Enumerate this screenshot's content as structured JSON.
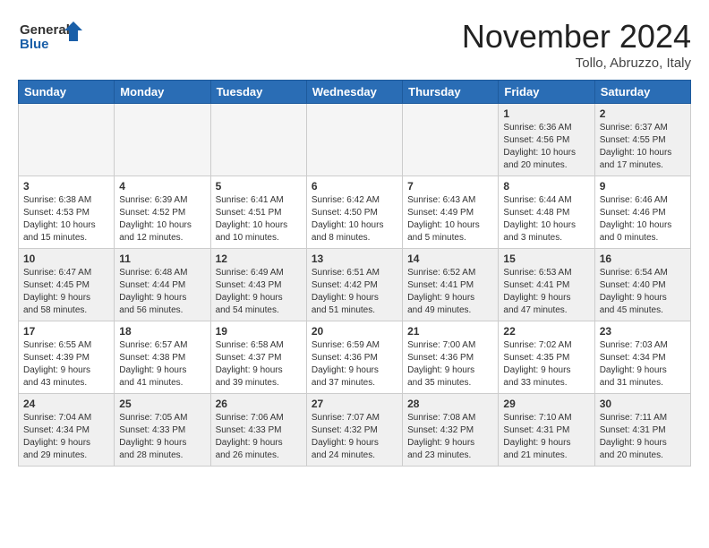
{
  "logo": {
    "line1": "General",
    "line2": "Blue"
  },
  "header": {
    "month": "November 2024",
    "location": "Tollo, Abruzzo, Italy"
  },
  "weekdays": [
    "Sunday",
    "Monday",
    "Tuesday",
    "Wednesday",
    "Thursday",
    "Friday",
    "Saturday"
  ],
  "weeks": [
    [
      {
        "day": "",
        "info": ""
      },
      {
        "day": "",
        "info": ""
      },
      {
        "day": "",
        "info": ""
      },
      {
        "day": "",
        "info": ""
      },
      {
        "day": "",
        "info": ""
      },
      {
        "day": "1",
        "info": "Sunrise: 6:36 AM\nSunset: 4:56 PM\nDaylight: 10 hours\nand 20 minutes."
      },
      {
        "day": "2",
        "info": "Sunrise: 6:37 AM\nSunset: 4:55 PM\nDaylight: 10 hours\nand 17 minutes."
      }
    ],
    [
      {
        "day": "3",
        "info": "Sunrise: 6:38 AM\nSunset: 4:53 PM\nDaylight: 10 hours\nand 15 minutes."
      },
      {
        "day": "4",
        "info": "Sunrise: 6:39 AM\nSunset: 4:52 PM\nDaylight: 10 hours\nand 12 minutes."
      },
      {
        "day": "5",
        "info": "Sunrise: 6:41 AM\nSunset: 4:51 PM\nDaylight: 10 hours\nand 10 minutes."
      },
      {
        "day": "6",
        "info": "Sunrise: 6:42 AM\nSunset: 4:50 PM\nDaylight: 10 hours\nand 8 minutes."
      },
      {
        "day": "7",
        "info": "Sunrise: 6:43 AM\nSunset: 4:49 PM\nDaylight: 10 hours\nand 5 minutes."
      },
      {
        "day": "8",
        "info": "Sunrise: 6:44 AM\nSunset: 4:48 PM\nDaylight: 10 hours\nand 3 minutes."
      },
      {
        "day": "9",
        "info": "Sunrise: 6:46 AM\nSunset: 4:46 PM\nDaylight: 10 hours\nand 0 minutes."
      }
    ],
    [
      {
        "day": "10",
        "info": "Sunrise: 6:47 AM\nSunset: 4:45 PM\nDaylight: 9 hours\nand 58 minutes."
      },
      {
        "day": "11",
        "info": "Sunrise: 6:48 AM\nSunset: 4:44 PM\nDaylight: 9 hours\nand 56 minutes."
      },
      {
        "day": "12",
        "info": "Sunrise: 6:49 AM\nSunset: 4:43 PM\nDaylight: 9 hours\nand 54 minutes."
      },
      {
        "day": "13",
        "info": "Sunrise: 6:51 AM\nSunset: 4:42 PM\nDaylight: 9 hours\nand 51 minutes."
      },
      {
        "day": "14",
        "info": "Sunrise: 6:52 AM\nSunset: 4:41 PM\nDaylight: 9 hours\nand 49 minutes."
      },
      {
        "day": "15",
        "info": "Sunrise: 6:53 AM\nSunset: 4:41 PM\nDaylight: 9 hours\nand 47 minutes."
      },
      {
        "day": "16",
        "info": "Sunrise: 6:54 AM\nSunset: 4:40 PM\nDaylight: 9 hours\nand 45 minutes."
      }
    ],
    [
      {
        "day": "17",
        "info": "Sunrise: 6:55 AM\nSunset: 4:39 PM\nDaylight: 9 hours\nand 43 minutes."
      },
      {
        "day": "18",
        "info": "Sunrise: 6:57 AM\nSunset: 4:38 PM\nDaylight: 9 hours\nand 41 minutes."
      },
      {
        "day": "19",
        "info": "Sunrise: 6:58 AM\nSunset: 4:37 PM\nDaylight: 9 hours\nand 39 minutes."
      },
      {
        "day": "20",
        "info": "Sunrise: 6:59 AM\nSunset: 4:36 PM\nDaylight: 9 hours\nand 37 minutes."
      },
      {
        "day": "21",
        "info": "Sunrise: 7:00 AM\nSunset: 4:36 PM\nDaylight: 9 hours\nand 35 minutes."
      },
      {
        "day": "22",
        "info": "Sunrise: 7:02 AM\nSunset: 4:35 PM\nDaylight: 9 hours\nand 33 minutes."
      },
      {
        "day": "23",
        "info": "Sunrise: 7:03 AM\nSunset: 4:34 PM\nDaylight: 9 hours\nand 31 minutes."
      }
    ],
    [
      {
        "day": "24",
        "info": "Sunrise: 7:04 AM\nSunset: 4:34 PM\nDaylight: 9 hours\nand 29 minutes."
      },
      {
        "day": "25",
        "info": "Sunrise: 7:05 AM\nSunset: 4:33 PM\nDaylight: 9 hours\nand 28 minutes."
      },
      {
        "day": "26",
        "info": "Sunrise: 7:06 AM\nSunset: 4:33 PM\nDaylight: 9 hours\nand 26 minutes."
      },
      {
        "day": "27",
        "info": "Sunrise: 7:07 AM\nSunset: 4:32 PM\nDaylight: 9 hours\nand 24 minutes."
      },
      {
        "day": "28",
        "info": "Sunrise: 7:08 AM\nSunset: 4:32 PM\nDaylight: 9 hours\nand 23 minutes."
      },
      {
        "day": "29",
        "info": "Sunrise: 7:10 AM\nSunset: 4:31 PM\nDaylight: 9 hours\nand 21 minutes."
      },
      {
        "day": "30",
        "info": "Sunrise: 7:11 AM\nSunset: 4:31 PM\nDaylight: 9 hours\nand 20 minutes."
      }
    ]
  ]
}
